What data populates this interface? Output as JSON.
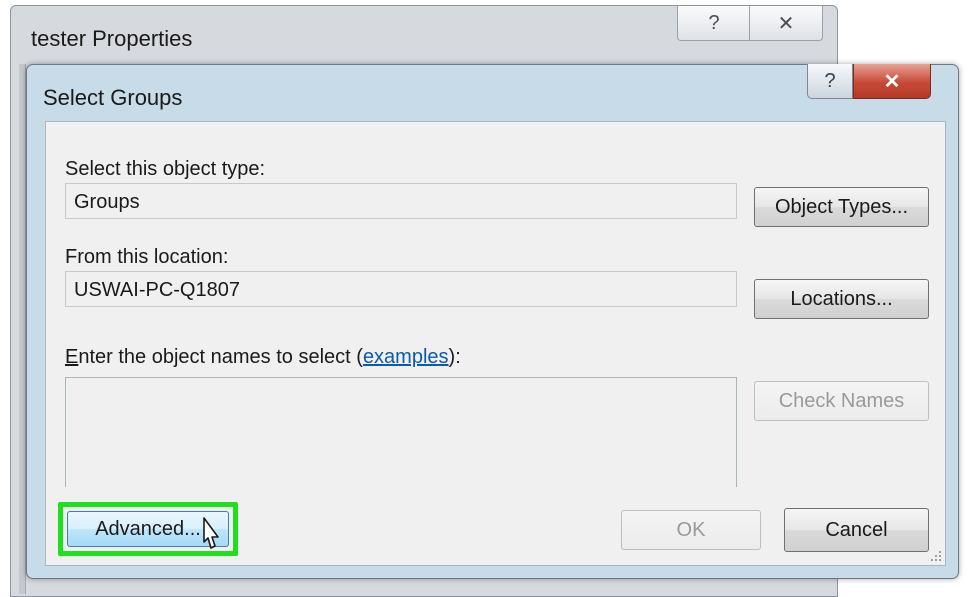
{
  "background_window": {
    "title": "tester Properties",
    "help_icon": "?",
    "close_icon": "✕"
  },
  "dialog": {
    "title": "Select Groups",
    "help_icon": "?",
    "close_icon": "✕",
    "object_type_label": "Select this object type:",
    "object_type_value": "Groups",
    "object_types_button": "Object Types...",
    "location_label": "From this location:",
    "location_value": "USWAI-PC-Q1807",
    "locations_button": "Locations...",
    "names_label_prefix_ul": "E",
    "names_label_prefix": "nter the object names to select (",
    "names_label_link": "examples",
    "names_label_suffix": "):",
    "names_value": "",
    "check_names_button": "Check Names",
    "advanced_button": "Advanced...",
    "ok_button": "OK",
    "cancel_button": "Cancel"
  },
  "colors": {
    "highlight": "#1fe01f",
    "dialog_frame": "#c7dbe9",
    "close_red": "#c74a36",
    "link": "#0b5ab1"
  },
  "icons": [
    "help-icon",
    "close-icon",
    "mouse-pointer-icon",
    "resize-grip-icon"
  ]
}
